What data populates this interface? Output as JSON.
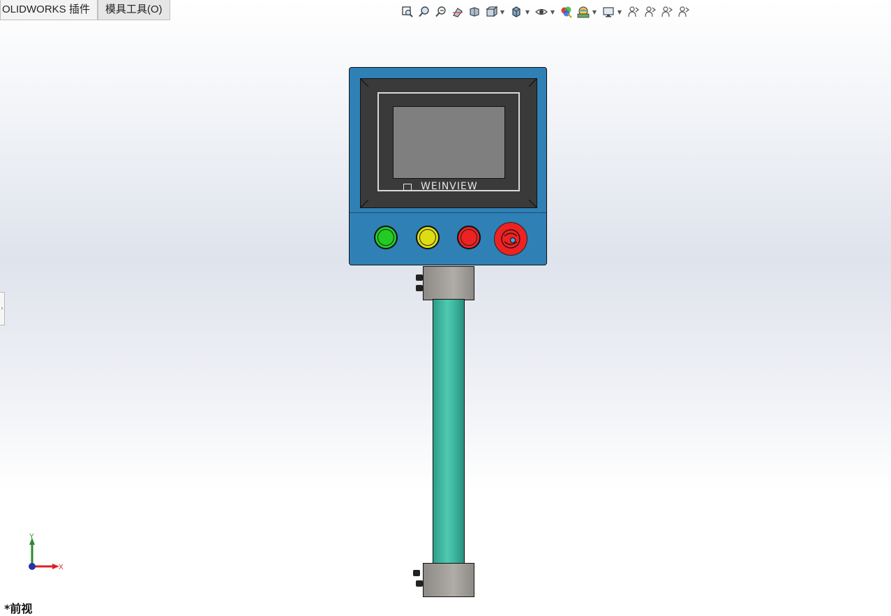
{
  "tabs": [
    {
      "label": "OLIDWORKS 插件"
    },
    {
      "label": "模具工具(O)"
    }
  ],
  "toolbar": {
    "icons": [
      "zoom-to-fit-icon",
      "zoom-to-area-icon",
      "previous-view-icon",
      "section-view-icon",
      "dynamic-annotation-icon",
      "view-orientation-icon",
      "display-style-icon",
      "hide-show-items-icon",
      "edit-appearance-icon",
      "apply-scene-icon",
      "view-settings-icon",
      "viewport-1-icon",
      "viewport-2-icon",
      "viewport-3-icon",
      "viewport-4-icon"
    ]
  },
  "model": {
    "hmi_brand": "WEINVIEW",
    "indicator_colors": [
      "#22cc22",
      "#dddd11",
      "#ee2222"
    ],
    "emergency_stop_color": "#ee2222",
    "enclosure_color": "#2f80b5",
    "pole_color": "#3bb59d"
  },
  "triad": {
    "y_label": "Y",
    "x_label": "X"
  },
  "view": {
    "label": "*前视"
  },
  "side_tab": {
    "glyph": "›"
  }
}
